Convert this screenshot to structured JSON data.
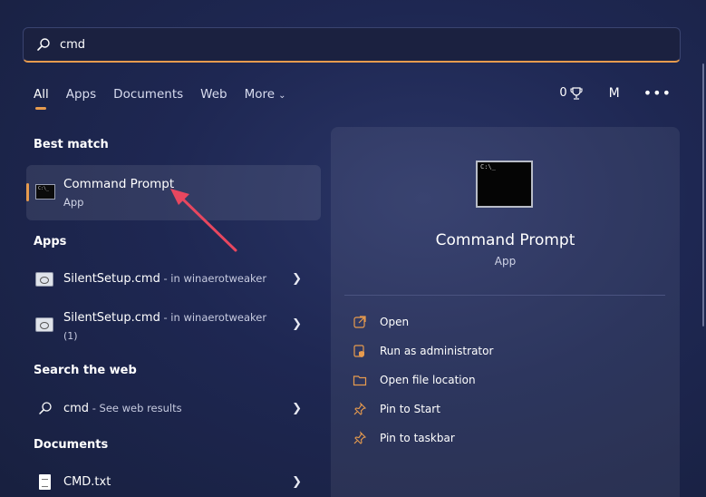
{
  "search": {
    "value": "cmd"
  },
  "tabs": [
    {
      "label": "All"
    },
    {
      "label": "Web"
    }
  ],
  "tabs_docs": "Documents",
  "tabs_apps": "Apps",
  "tabs_more": "More",
  "header": {
    "points": "0",
    "avatar": "M",
    "more_options": "•••"
  },
  "best_match": {
    "heading": "Best match",
    "title": "Command Prompt",
    "subtitle": "App"
  },
  "apps": {
    "heading": "Apps",
    "items": [
      {
        "name": "SilentSetup.cmd",
        "location": " - in winaerotweaker"
      },
      {
        "name": "SilentSetup.cmd",
        "location": " - in winaerotweaker",
        "extra": "(1)"
      }
    ]
  },
  "web": {
    "heading": "Search the web",
    "query": "cmd",
    "suffix": " - See web results"
  },
  "documents": {
    "heading": "Documents",
    "items": [
      {
        "name": "CMD.txt"
      }
    ]
  },
  "panel": {
    "title": "Command Prompt",
    "subtitle": "App",
    "actions": [
      {
        "label": "Open",
        "icon": "open-icon"
      },
      {
        "label": "Run as administrator",
        "icon": "shield-icon"
      },
      {
        "label": "Open file location",
        "icon": "folder-icon"
      },
      {
        "label": "Pin to Start",
        "icon": "pin-icon"
      },
      {
        "label": "Pin to taskbar",
        "icon": "pin-icon"
      }
    ]
  },
  "colors": {
    "accent": "#e79b4e",
    "annotation_arrow": "#e8475f"
  }
}
